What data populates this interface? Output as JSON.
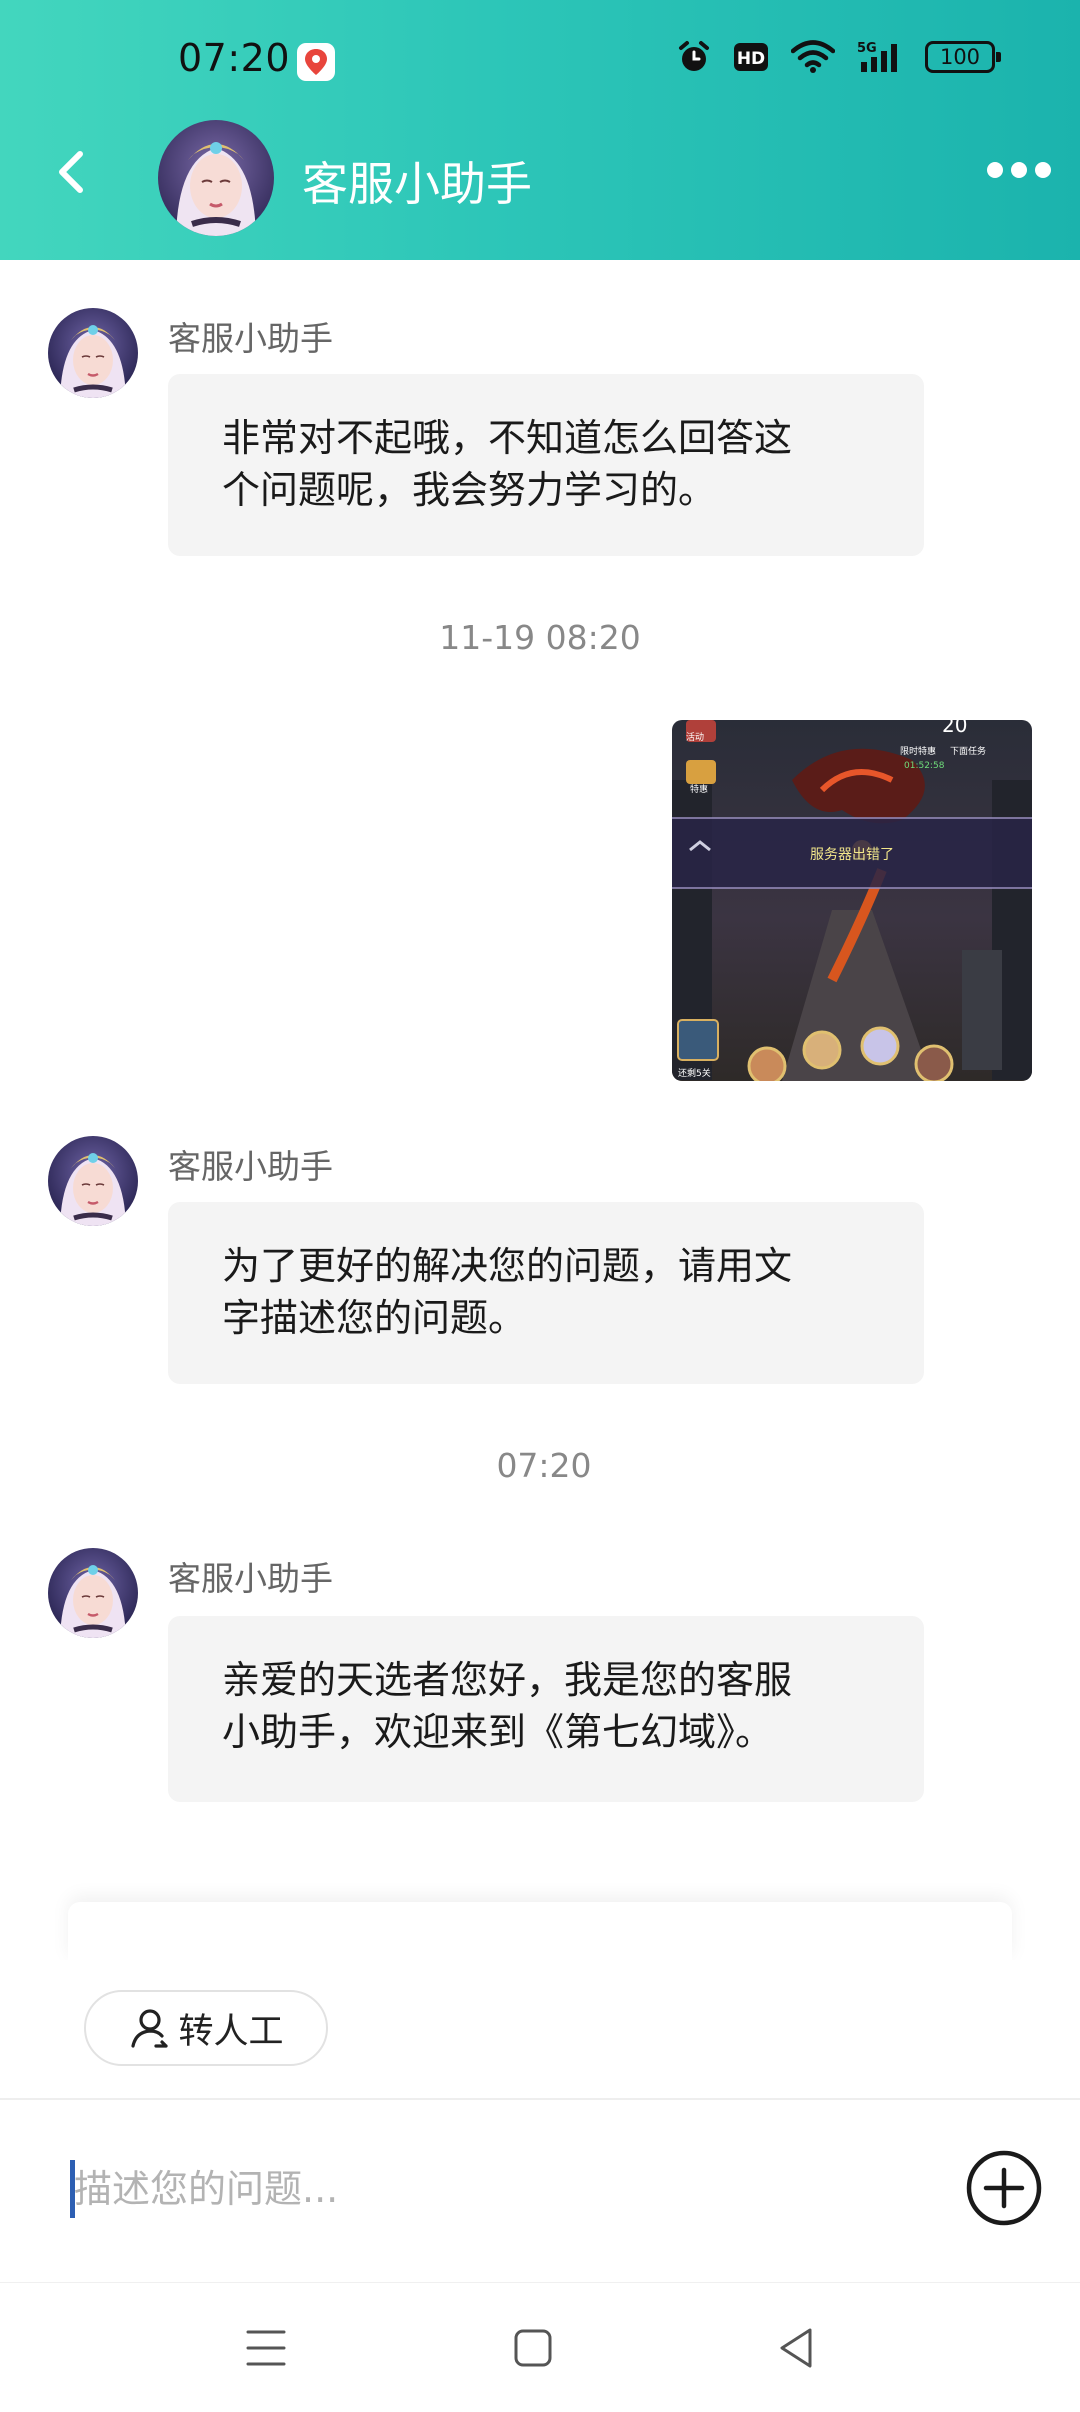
{
  "status_bar": {
    "time": "07:20",
    "battery": "100",
    "icons": [
      "map-pin-app-icon",
      "alarm-icon",
      "hd-icon",
      "wifi-icon",
      "5g-signal-icon",
      "battery-icon"
    ]
  },
  "header": {
    "title": "客服小助手",
    "colors": {
      "gradient_start": "#43d6be",
      "gradient_end": "#1bb3ad"
    }
  },
  "messages": [
    {
      "type": "received",
      "sender": "客服小助手",
      "lines": [
        "非常对不起哦，不知道怎么回答这",
        "个问题呢，我会努力学习的。"
      ]
    },
    {
      "type": "timestamp",
      "text": "11-19 08:20"
    },
    {
      "type": "sent_image",
      "caption": "服务器出错了",
      "game_ui": {
        "tl1": "活动",
        "tl2": "特惠",
        "tr_num": "20",
        "tr_sub": "限时特惠",
        "tr_sub2": "下面任务",
        "tr_time": "01:52:58",
        "bl": "还剩5关"
      }
    },
    {
      "type": "received",
      "sender": "客服小助手",
      "lines": [
        "为了更好的解决您的问题，请用文",
        "字描述您的问题。"
      ]
    },
    {
      "type": "timestamp",
      "text": "07:20"
    },
    {
      "type": "received",
      "sender": "客服小助手",
      "lines": [
        "亲爱的天选者您好，我是您的客服",
        "小助手，欢迎来到《第七幻域》。"
      ]
    }
  ],
  "quick_actions": {
    "transfer_label": "转人工"
  },
  "input": {
    "placeholder": "描述您的问题...",
    "value": ""
  }
}
